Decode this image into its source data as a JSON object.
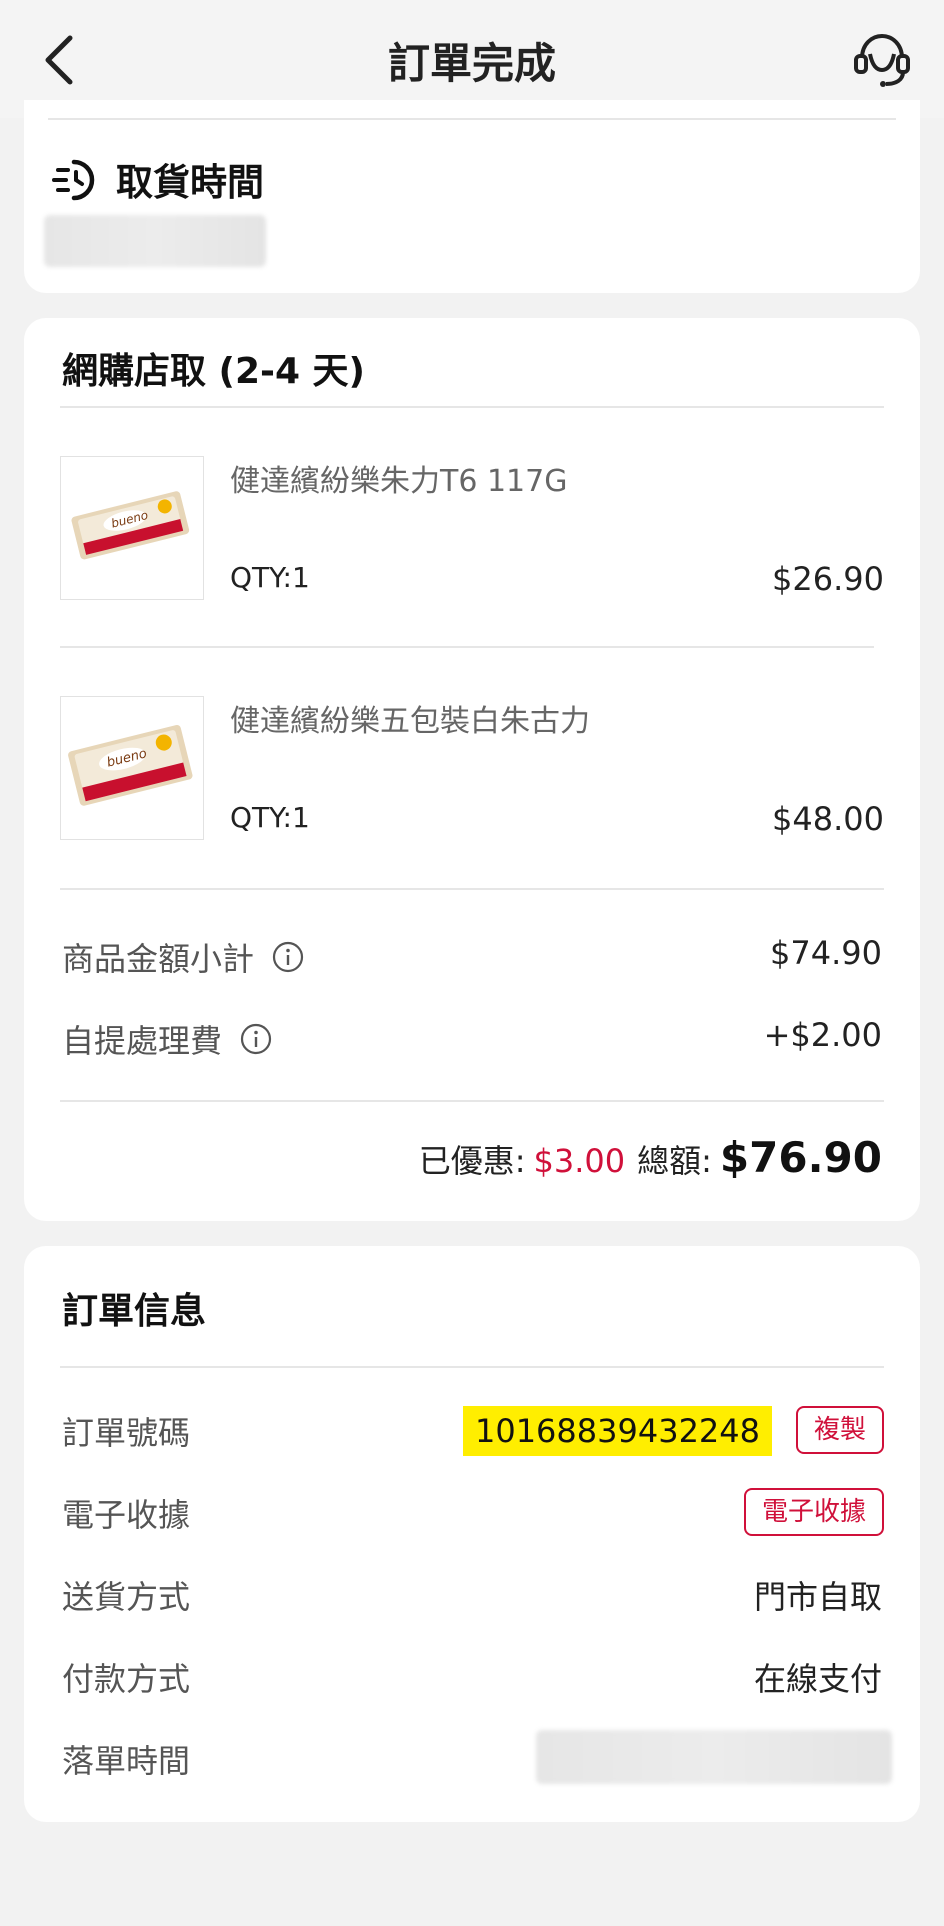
{
  "header": {
    "title": "訂單完成"
  },
  "pickup": {
    "title": "取貨時間"
  },
  "order_group": {
    "title": "網購店取 (2-4 天)",
    "items": [
      {
        "name": "健達繽紛樂朱力T6 117G",
        "qty": "QTY:1",
        "price": "$26.90"
      },
      {
        "name": "健達繽紛樂五包裝白朱古力",
        "qty": "QTY:1",
        "price": "$48.00"
      }
    ],
    "subtotal_label": "商品金額小計",
    "subtotal_value": "$74.90",
    "handling_label": "自提處理費",
    "handling_value": "+$2.00",
    "discount_label": "已優惠:",
    "discount_value": "$3.00",
    "total_label": "總額:",
    "total_value": "$76.90"
  },
  "order_info": {
    "title": "訂單信息",
    "order_no_label": "訂單號碼",
    "order_no_value": "10168839432248",
    "copy_label": "複製",
    "receipt_label": "電子收據",
    "receipt_button": "電子收據",
    "delivery_label": "送貨方式",
    "delivery_value": "門市自取",
    "payment_label": "付款方式",
    "payment_value": "在線支付",
    "order_time_label": "落單時間"
  },
  "colors": {
    "accent": "#d0103a",
    "highlight": "#ffee00",
    "background": "#f2f2f2"
  }
}
